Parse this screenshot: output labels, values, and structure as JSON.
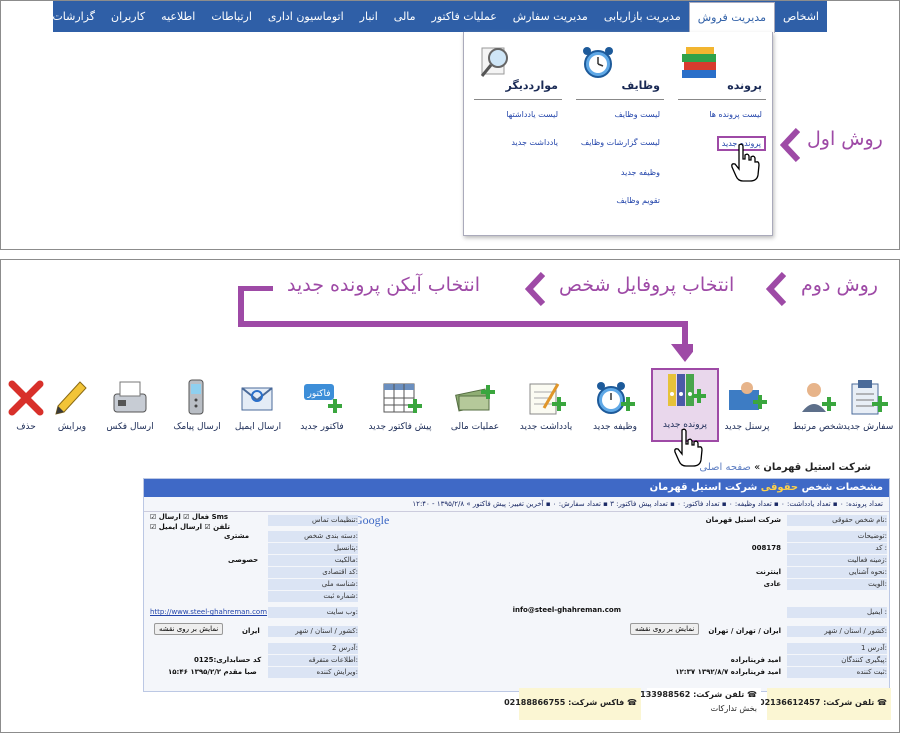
{
  "menu": {
    "items": [
      "اشخاص",
      "مدیریت فروش",
      "مدیریت بازاریابی",
      "مدیریت سفارش",
      "عملیات فاکتور",
      "مالی",
      "انبار",
      "اتوماسیون اداری",
      "ارتباطات",
      "اطلاعیه",
      "کاربران",
      "گزارشات"
    ]
  },
  "dropdown": {
    "col1_title": "پرونده",
    "col1_links": [
      "لیست پرونده ها",
      "پرونده جدید"
    ],
    "col2_title": "وظایف",
    "col2_links": [
      "لیست وظایف",
      "لیست گزارشات وظایف",
      "وظیفه جدید",
      "تقویم وظایف"
    ],
    "col3_title": "مواردديگر",
    "col3_links": [
      "لیست یادداشتها",
      "یادداشت جدید"
    ]
  },
  "callouts": {
    "method1": "روش اول",
    "method2": "روش دوم",
    "step1": "انتخاب پروفایل شخص",
    "step2": "انتخاب آیکن پرونده جدید"
  },
  "toolbar": {
    "items": [
      "سفارش جدید",
      "شخص مرتبط",
      "پرسنل جدید",
      "پرونده جدید",
      "وظیفه جدید",
      "یادداشت جدید",
      "عملیات مالی",
      "پیش فاکتور جدید",
      "فاکتور جدید",
      "ارسال ایمیل",
      "ارسال پیامک",
      "ارسال فکس",
      "ویرایش",
      "حذف"
    ]
  },
  "icons": {
    "order": "order-icon",
    "related_person": "person-add-icon",
    "staff": "staff-icon",
    "file": "file-binder-icon",
    "task": "alarm-clock-icon",
    "note": "note-icon",
    "finance": "money-icon",
    "proforma": "table-icon",
    "invoice": "invoice-icon",
    "email": "email-icon",
    "sms": "mobile-icon",
    "fax": "fax-icon",
    "edit": "pencil-icon",
    "delete": "delete-icon"
  },
  "breadcrumb": {
    "home": "صفحه اصلی",
    "sep": "»",
    "current": "شرکت استیل قهرمان"
  },
  "profile": {
    "header_prefix": "مشخصات شخص",
    "header_type": "حقوقی",
    "header_name": "شرکت استیل قهرمان",
    "counts": "تعداد پرونده: ۰ ▪ تعداد یادداشت: ۰ ▪ تعداد وظیفه: ۰ ▪ تعداد فاکتور: ۰ ▪ تعداد پیش فاکتور: ۳ ▪ تعداد سفارش: ۰ ▪ آخرین تغییر: پیش فاکتور » ۱۳۹۵/۲/۸ - ۱۲:۴۰",
    "labels_right": [
      "نام شخص حقوقی:",
      "توضیحات:",
      "کد :",
      "زمینه فعالیت:",
      "نحوه آشنایی:",
      "الویت:",
      "ایمیل :",
      "کشور / استان / شهر:",
      "آدرس 1:",
      "پیگیری کنندگان:",
      "ثبت کننده:"
    ],
    "values_right": [
      "شرکت استیل قهرمان",
      "",
      "008178",
      "",
      "اینترنت",
      "عادی",
      "info@steel-ghahreman.com",
      "ایران / تهران / تهران",
      "",
      "امید فرینابراده",
      "امید فرینابراده ۱۳۹۲/۸/۷ ۱۲:۳۷"
    ],
    "labels_left": [
      "تنظیمات تماس:",
      "دسته بندی شخص:",
      "پتانسیل:",
      "مالکیت:",
      "کد اقتصادی:",
      "شناسه ملی:",
      "شماره ثبت:",
      "وب سایت:",
      "کشور / استان / شهر:",
      "آدرس 2:",
      "اطلاعات متفرقه:",
      "ویرایش کننده:"
    ],
    "values_left": [
      "",
      "مشتری",
      "",
      "حصوصی",
      "",
      "",
      "",
      "http://www.steel-ghahreman.com",
      "ایران",
      "",
      "کد حسابداری:0125",
      "صبا مقدم ۱۳۹۵/۲/۲ ۱۵:۴۶"
    ],
    "checks": [
      "فعال",
      "ارسال Sms",
      "تلفن",
      "ارسال ایمیل"
    ],
    "map_button": "نمایش بر روی نقشه",
    "google": "Google"
  },
  "phones": [
    {
      "label": "تلفن شرکت:",
      "value": "02136612457"
    },
    {
      "label": "تلفن شرکت:",
      "value": "02133988562",
      "note": "بخش تدارکات"
    },
    {
      "label": "فاکس شرکت:",
      "value": "02188866755"
    }
  ],
  "colors": {
    "menu_blue": "#2f5fa7",
    "callout_purple": "#9e4aa6",
    "header_blue": "#3f69c6"
  }
}
